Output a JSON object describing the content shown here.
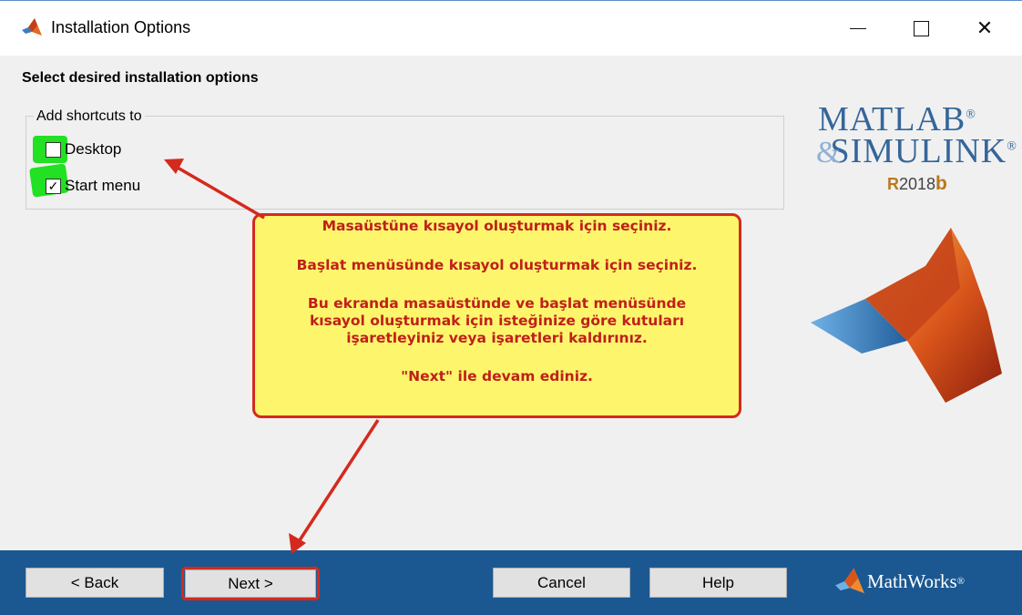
{
  "window": {
    "title": "Installation Options",
    "controls": [
      "minimize",
      "maximize",
      "close"
    ],
    "close_glyph": "✕"
  },
  "heading": "Select desired installation options",
  "shortcuts": {
    "group_label": "Add shortcuts to",
    "options": [
      {
        "label": "Desktop",
        "checked": false
      },
      {
        "label": "Start menu",
        "checked": true
      }
    ],
    "check_glyph": "✓",
    "highlight_color": "#22e022"
  },
  "branding": {
    "line1": "MATLAB",
    "line1_mark": "®",
    "line2_prefix": "&",
    "line2": "SIMULINK",
    "line2_mark": "®",
    "release_r": "R",
    "release_year": "2018",
    "release_b": "b"
  },
  "callout": {
    "line1": "Masaüstüne kısayol oluşturmak için seçiniz.",
    "line2": "Başlat menüsünde kısayol oluşturmak için seçiniz.",
    "line3": "Bu ekranda masaüstünde ve başlat menüsünde",
    "line4": "kısayol oluşturmak için isteğinize göre kutuları",
    "line5": "işaretleyiniz veya işaretleri kaldırınız.",
    "line6": "\"Next\" ile devam ediniz.",
    "bg_color": "#fdf66d",
    "border_color": "#d42a1d",
    "text_color": "#c0201a"
  },
  "buttons": {
    "back": "< Back",
    "next": "Next >",
    "cancel": "Cancel",
    "help": "Help"
  },
  "footer": {
    "company": "MathWorks",
    "company_mark": "®",
    "bg_color": "#1b5891"
  },
  "icons": [
    "matlab-logo-icon",
    "minimize-icon",
    "maximize-icon",
    "close-icon",
    "check-icon",
    "membrane-logo-icon",
    "mathworks-logo-icon",
    "arrow-icon"
  ]
}
